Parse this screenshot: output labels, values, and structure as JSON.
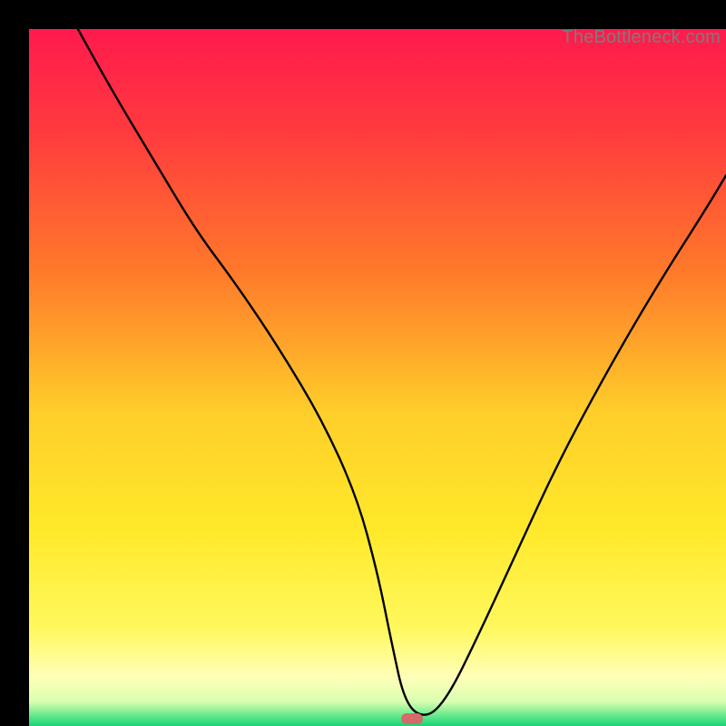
{
  "watermark": "TheBottleneck.com",
  "colors": {
    "frame": "#000000",
    "curve": "#000000",
    "marker": "#d46a6a",
    "gradient_stops": [
      {
        "pos": 0.0,
        "color": "#ff1a4d"
      },
      {
        "pos": 0.15,
        "color": "#ff3b3e"
      },
      {
        "pos": 0.35,
        "color": "#ff7a2a"
      },
      {
        "pos": 0.55,
        "color": "#ffce2a"
      },
      {
        "pos": 0.72,
        "color": "#ffe92a"
      },
      {
        "pos": 0.86,
        "color": "#fff85e"
      },
      {
        "pos": 0.93,
        "color": "#ffffb8"
      },
      {
        "pos": 0.965,
        "color": "#d9ffb0"
      },
      {
        "pos": 0.985,
        "color": "#67e88c"
      },
      {
        "pos": 1.0,
        "color": "#14d477"
      }
    ]
  },
  "chart_data": {
    "type": "line",
    "title": "",
    "xlabel": "",
    "ylabel": "",
    "xlim": [
      0,
      100
    ],
    "ylim": [
      0,
      100
    ],
    "grid": false,
    "legend": false,
    "marker": {
      "x": 55,
      "y": 1
    },
    "series": [
      {
        "name": "bottleneck-curve",
        "x": [
          7,
          12,
          18,
          24,
          30,
          36,
          42,
          47,
          50,
          52,
          54,
          57,
          60,
          64,
          70,
          76,
          83,
          90,
          97,
          100
        ],
        "y": [
          100,
          91,
          81,
          71,
          63,
          54,
          44,
          33,
          22,
          12,
          3,
          1,
          4,
          12,
          25,
          38,
          51,
          63,
          74,
          79
        ]
      }
    ]
  }
}
